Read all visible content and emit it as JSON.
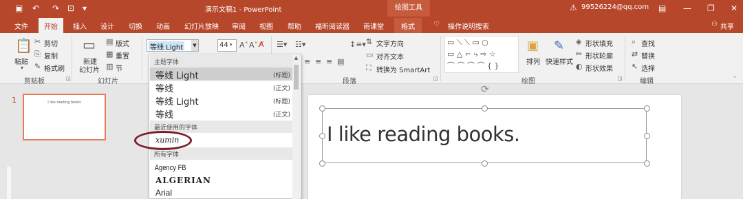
{
  "titlebar": {
    "title": "演示文稿1  -  PowerPoint",
    "contextual_label": "绘图工具",
    "account": "99526224@qq.com",
    "warning": "⚠",
    "icons": [
      "save-icon",
      "undo-icon",
      "redo-icon",
      "present-icon",
      "customize-icon",
      "ribbon-display-icon",
      "minimize-icon",
      "restore-icon",
      "close-icon"
    ]
  },
  "tabs": {
    "file": "文件",
    "home": "开始",
    "insert": "插入",
    "design": "设计",
    "transitions": "切换",
    "animations": "动画",
    "slideshow": "幻灯片放映",
    "review": "审阅",
    "view": "视图",
    "help": "帮助",
    "foxit": "福昕阅读器",
    "rainclass": "雨课堂",
    "format": "格式",
    "tellme": "操作说明搜索",
    "share": "共享"
  },
  "ribbon": {
    "clipboard": {
      "paste": "粘贴",
      "cut": "剪切",
      "copy": "复制",
      "format_painter": "格式刷",
      "label": "剪贴板"
    },
    "slides": {
      "new_slide_l1": "新建",
      "new_slide_l2": "幻灯片",
      "layout": "版式",
      "reset": "重置",
      "section": "节",
      "label": "幻灯片"
    },
    "font": {
      "font_name": "等线 Light",
      "font_size": "44"
    },
    "paragraph": {
      "text_direction": "文字方向",
      "align_text": "对齐文本",
      "convert_smartart": "转换为 SmartArt",
      "label": "段落"
    },
    "drawing": {
      "arrange": "排列",
      "quick_styles": "快速样式",
      "shape_fill": "形状填充",
      "shape_outline": "形状轮廓",
      "shape_effects": "形状效果",
      "label": "绘图"
    },
    "editing": {
      "find": "查找",
      "replace": "替换",
      "select": "选择",
      "label": "编辑"
    }
  },
  "slide_pane": {
    "number": "1",
    "thumb_text": "I like reading books"
  },
  "slide": {
    "text": "I like reading books."
  },
  "font_dropdown": {
    "theme_header": "主题字体",
    "theme_fonts": [
      {
        "name": "等线 Light",
        "tag": "(标题)"
      },
      {
        "name": "等线",
        "tag": "(正文)"
      },
      {
        "name": "等线 Light",
        "tag": "(标题)"
      },
      {
        "name": "等线",
        "tag": "(正文)"
      }
    ],
    "recent_header": "最近使用的字体",
    "recent_fonts": [
      "xumin"
    ],
    "all_header": "所有字体",
    "all_fonts": [
      "Agency FB",
      "ALGERIAN",
      "Arial"
    ]
  }
}
